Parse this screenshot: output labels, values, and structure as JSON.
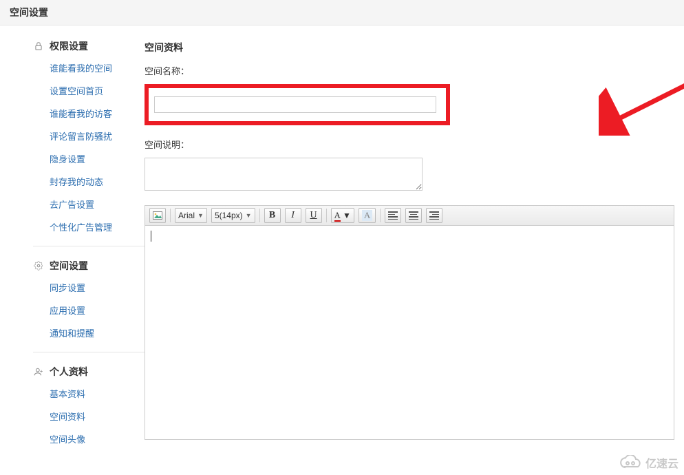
{
  "header": {
    "title": "空间设置"
  },
  "sidebar": {
    "sections": [
      {
        "icon": "lock-icon",
        "title": "权限设置",
        "items": [
          "谁能看我的空间",
          "设置空间首页",
          "谁能看我的访客",
          "评论留言防骚扰",
          "隐身设置",
          "封存我的动态",
          "去广告设置",
          "个性化广告管理"
        ]
      },
      {
        "icon": "gear-icon",
        "title": "空间设置",
        "items": [
          "同步设置",
          "应用设置",
          "通知和提醒"
        ]
      },
      {
        "icon": "person-icon",
        "title": "个人资料",
        "items": [
          "基本资料",
          "空间资料",
          "空间头像"
        ]
      }
    ]
  },
  "main": {
    "section_title": "空间资料",
    "name_label": "空间名称：",
    "name_value": "",
    "desc_label": "空间说明：",
    "desc_value": "",
    "editor_content": ""
  },
  "toolbar": {
    "font_family": "Arial",
    "font_size": "5(14px)",
    "bold": "B",
    "italic": "I",
    "underline": "U",
    "color_a": "A",
    "color_bg": "A"
  },
  "watermark": {
    "text": "亿速云"
  },
  "colors": {
    "link": "#2b6daf",
    "highlight": "#ec1c24",
    "header_bg": "#f5f5f5"
  }
}
